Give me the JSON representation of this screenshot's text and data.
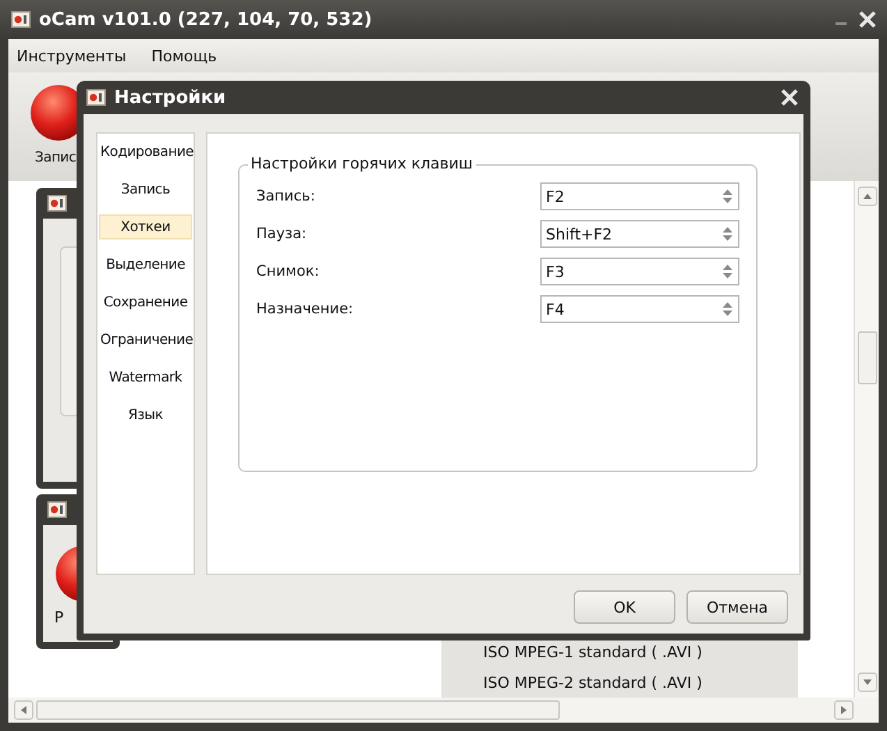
{
  "window": {
    "title": "oCam v101.0 (227, 104, 70, 532)"
  },
  "menu": [
    {
      "label": "Инструменты"
    },
    {
      "label": "Помощь"
    }
  ],
  "toolbar": [
    {
      "label": "Запис"
    }
  ],
  "mini_window": {
    "label": "Р"
  },
  "format_list": [
    "ISO MPEG-1 standard ( .AVI )",
    "ISO MPEG-2 standard ( .AVI )"
  ],
  "dialog": {
    "title": "Настройки",
    "sidebar": [
      {
        "label": "Кодирование",
        "selected": false
      },
      {
        "label": "Запись",
        "selected": false
      },
      {
        "label": "Хоткеи",
        "selected": true
      },
      {
        "label": "Выделение",
        "selected": false
      },
      {
        "label": "Сохранение",
        "selected": false
      },
      {
        "label": "Ограничение",
        "selected": false
      },
      {
        "label": "Watermark",
        "selected": false
      },
      {
        "label": "Язык",
        "selected": false
      }
    ],
    "group": {
      "title": "Настройки горячих клавиш",
      "fields": [
        {
          "label": "Запись:",
          "value": "F2"
        },
        {
          "label": "Пауза:",
          "value": "Shift+F2"
        },
        {
          "label": "Снимок:",
          "value": "F3"
        },
        {
          "label": "Назначение:",
          "value": "F4"
        }
      ]
    },
    "buttons": [
      "OK",
      "Отмена"
    ]
  }
}
